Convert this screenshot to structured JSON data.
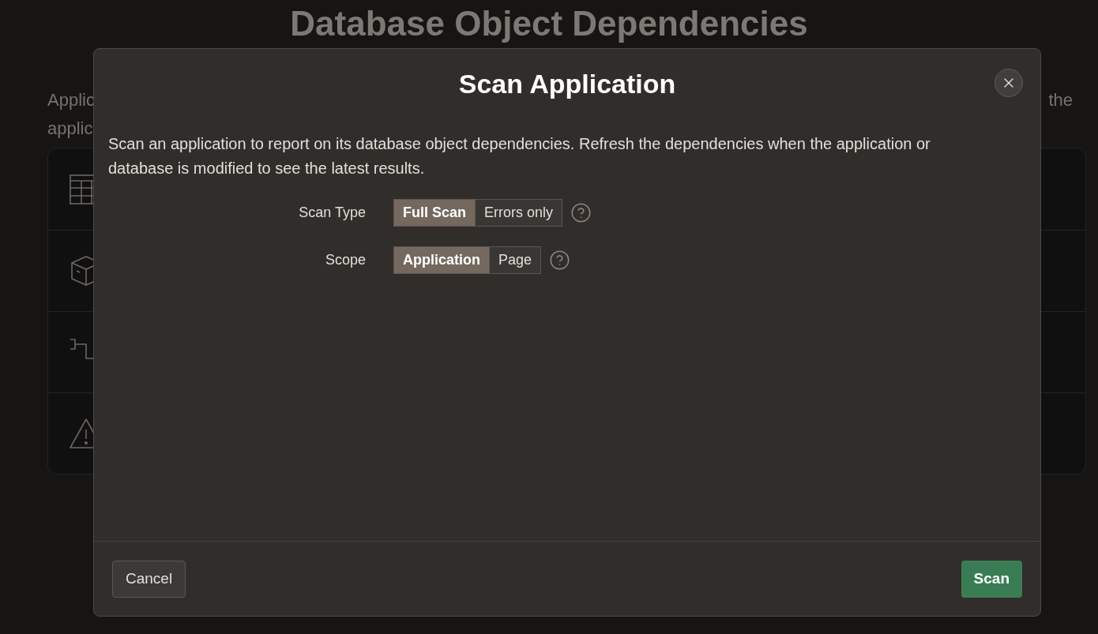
{
  "page": {
    "title": "Database Object Dependencies",
    "intro": {
      "line_1_start": "Applic",
      "line_1_end": "the",
      "line_2_start": "applic"
    },
    "list": [
      {
        "kind": "table"
      },
      {
        "kind": "box"
      },
      {
        "kind": "steps"
      },
      {
        "kind": "warning"
      }
    ]
  },
  "dialog": {
    "title": "Scan Application",
    "description": "Scan an application to report on its database object dependencies. Refresh the dependencies when the application or database is modified to see the latest results.",
    "fields": [
      {
        "label": "Scan Type",
        "help": true,
        "options": [
          {
            "label": "Full Scan",
            "selected": true
          },
          {
            "label": "Errors only",
            "selected": false
          }
        ]
      },
      {
        "label": "Scope",
        "help": true,
        "options": [
          {
            "label": "Application",
            "selected": true
          },
          {
            "label": "Page",
            "selected": false
          }
        ]
      }
    ],
    "buttons": [
      {
        "label": "Cancel",
        "kind": "secondary"
      },
      {
        "label": "Scan",
        "kind": "primary"
      }
    ]
  }
}
